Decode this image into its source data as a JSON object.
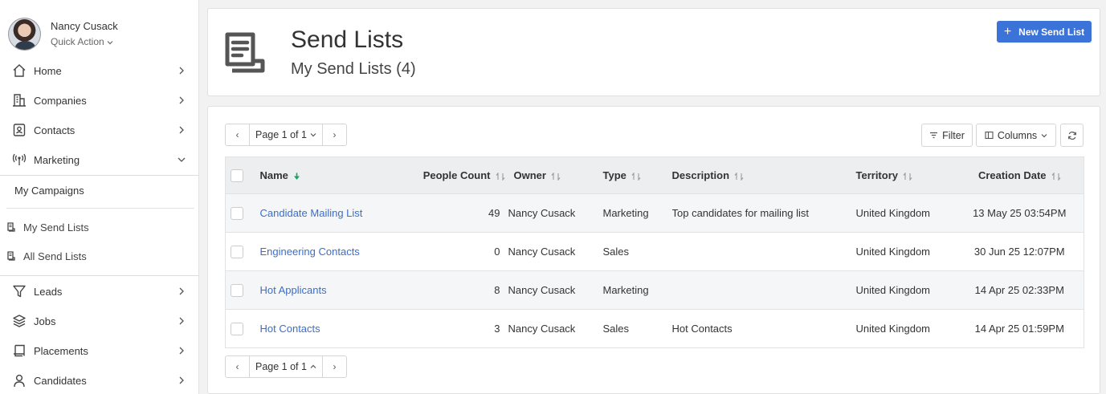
{
  "user": {
    "name": "Nancy Cusack",
    "quick_action": "Quick Action"
  },
  "nav": {
    "home": "Home",
    "companies": "Companies",
    "contacts": "Contacts",
    "marketing": "Marketing",
    "leads": "Leads",
    "jobs": "Jobs",
    "placements": "Placements",
    "candidates": "Candidates"
  },
  "submenu": {
    "campaigns": "My Campaigns",
    "my_send_lists": "My Send Lists",
    "all_send_lists": "All Send Lists"
  },
  "header": {
    "title": "Send Lists",
    "subtitle": "My Send Lists (4)",
    "new_button": "New Send List",
    "new_plus": "+"
  },
  "pager": {
    "label": "Page 1 of 1",
    "prev": "‹",
    "next": "›"
  },
  "toolbar": {
    "filter": "Filter",
    "columns": "Columns"
  },
  "table": {
    "headers": {
      "name": "Name",
      "people_count": "People Count",
      "owner": "Owner",
      "type": "Type",
      "description": "Description",
      "territory": "Territory",
      "creation_date": "Creation Date"
    },
    "rows": [
      {
        "name": "Candidate Mailing List",
        "people_count": "49",
        "owner": "Nancy Cusack",
        "type": "Marketing",
        "description": "Top candidates for mailing list",
        "territory": "United Kingdom",
        "creation_date": "13 May 25 03:54PM"
      },
      {
        "name": "Engineering Contacts",
        "people_count": "0",
        "owner": "Nancy Cusack",
        "type": "Sales",
        "description": "",
        "territory": "United Kingdom",
        "creation_date": "30 Jun 25 12:07PM"
      },
      {
        "name": "Hot Applicants",
        "people_count": "8",
        "owner": "Nancy Cusack",
        "type": "Marketing",
        "description": "",
        "territory": "United Kingdom",
        "creation_date": "14 Apr 25 02:33PM"
      },
      {
        "name": "Hot Contacts",
        "people_count": "3",
        "owner": "Nancy Cusack",
        "type": "Sales",
        "description": "Hot Contacts",
        "territory": "United Kingdom",
        "creation_date": "14 Apr 25 01:59PM"
      }
    ]
  },
  "colors": {
    "accent": "#3b73d9",
    "link": "#3b6ec8",
    "sort_active": "#1aa260"
  }
}
